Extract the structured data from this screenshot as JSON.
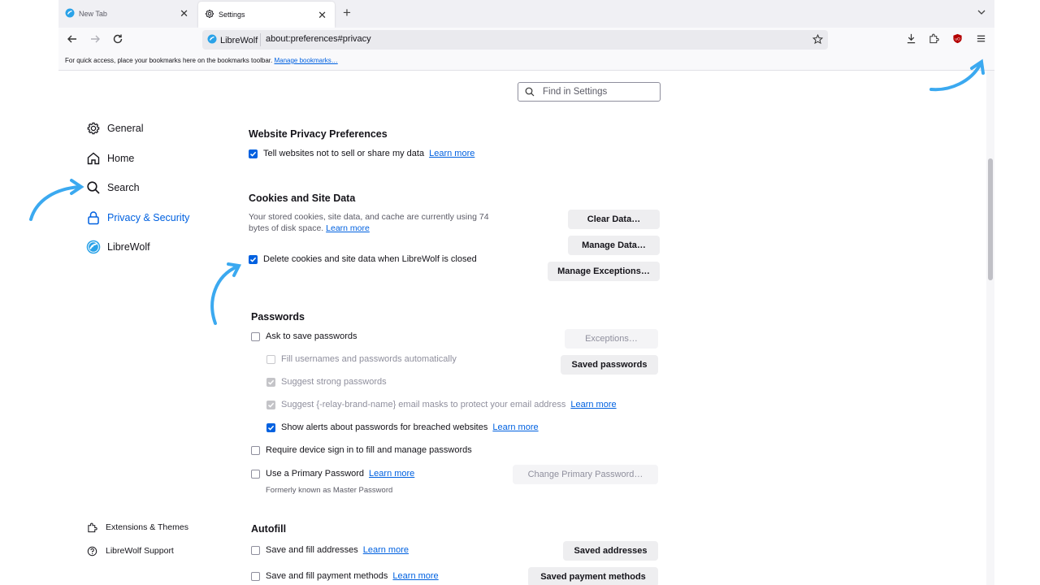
{
  "tabs": [
    {
      "label": "New Tab",
      "active": false
    },
    {
      "label": "Settings",
      "active": true
    }
  ],
  "urlbar": {
    "identity_label": "LibreWolf",
    "url": "about:preferences#privacy"
  },
  "bookmarks_bar": {
    "message": "For quick access, place your bookmarks here on the bookmarks toolbar.",
    "manage_link": "Manage bookmarks…"
  },
  "search": {
    "placeholder": "Find in Settings"
  },
  "sidebar": {
    "categories": [
      {
        "label": "General",
        "icon": "gear-icon"
      },
      {
        "label": "Home",
        "icon": "home-icon"
      },
      {
        "label": "Search",
        "icon": "search-icon"
      },
      {
        "label": "Privacy & Security",
        "icon": "lock-icon",
        "selected": true
      },
      {
        "label": "LibreWolf",
        "icon": "librewolf-icon"
      }
    ],
    "footer": [
      {
        "label": "Extensions & Themes",
        "icon": "puzzle-icon"
      },
      {
        "label": "LibreWolf Support",
        "icon": "help-icon"
      }
    ]
  },
  "privacy_prefs": {
    "heading": "Website Privacy Preferences",
    "gpc_label": "Tell websites not to sell or share my data",
    "gpc_checked": true,
    "learn_more": "Learn more"
  },
  "cookies": {
    "heading": "Cookies and Site Data",
    "description": "Your stored cookies, site data, and cache are currently using 74 bytes of disk space.",
    "desc_line1": "Your stored cookies, site data, and cache are currently using 74",
    "desc_line2": "bytes of disk space.",
    "learn_more": "Learn more",
    "clear_data": "Clear Data…",
    "manage_data": "Manage Data…",
    "manage_exceptions": "Manage Exceptions…",
    "delete_on_close_label": "Delete cookies and site data when LibreWolf is closed",
    "delete_on_close_checked": true
  },
  "passwords": {
    "heading": "Passwords",
    "ask_to_save": "Ask to save passwords",
    "exceptions": "Exceptions…",
    "saved_passwords": "Saved passwords",
    "autofill": "Fill usernames and passwords automatically",
    "suggest_strong": "Suggest strong passwords",
    "suggest_relay": "Suggest {-relay-brand-name} email masks to protect your email address",
    "breach_alerts": "Show alerts about passwords for breached websites",
    "require_signin": "Require device sign in to fill and manage passwords",
    "primary_password": "Use a Primary Password",
    "change_primary": "Change Primary Password…",
    "formerly": "Formerly known as Master Password",
    "learn_more": "Learn more"
  },
  "autofill": {
    "heading": "Autofill",
    "addresses": "Save and fill addresses",
    "saved_addresses": "Saved addresses",
    "payments": "Save and fill payment methods",
    "saved_payments": "Saved payment methods",
    "learn_more": "Learn more"
  },
  "colors": {
    "accent": "#0061e0",
    "annotation_arrow": "#3ba9f0"
  }
}
